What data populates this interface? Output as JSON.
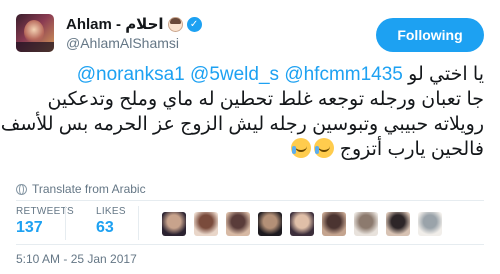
{
  "user": {
    "display_name": "Ahlam - احلام",
    "handle": "@AhlamAlShamsi",
    "verified": true,
    "avatar_icon": "profile-photo"
  },
  "follow_button": {
    "label": "Following",
    "color": "#1da1f2"
  },
  "tweet": {
    "lines": [
      [
        "@noranksa1 ",
        "@5weld_s ",
        "@hfcmm1435 ",
        "يا اختي لو"
      ],
      "جا تعبان ورجله توجعه غلط تحطين له ماي وملح وتدعكين",
      "رويلاته حبيبي وتبوسين رجله ليش الزوج عز الحرمه بس للأسف",
      "فالحين يارب أتزوج"
    ],
    "mentions": [
      "@noranksa1",
      "@5weld_s",
      "@hfcmm1435"
    ],
    "emojis": [
      "face-with-tears-of-joy",
      "face-with-tears-of-joy"
    ]
  },
  "translate": {
    "label": "Translate from Arabic",
    "icon": "globe-icon"
  },
  "stats": {
    "retweets_label": "RETWEETS",
    "retweets_value": "137",
    "likes_label": "LIKES",
    "likes_value": "63"
  },
  "likers": [
    {
      "colors": [
        "#2b2230",
        "#c8a38c"
      ]
    },
    {
      "colors": [
        "#e9d6c9",
        "#7a4b3c"
      ]
    },
    {
      "colors": [
        "#d7b9a4",
        "#5a3c3a"
      ]
    },
    {
      "colors": [
        "#1d1a1f",
        "#b39077"
      ]
    },
    {
      "colors": [
        "#3b2d3a",
        "#e0bfa8"
      ]
    },
    {
      "colors": [
        "#c4a48f",
        "#4b3431"
      ]
    },
    {
      "colors": [
        "#e8e2dc",
        "#8c7a6e"
      ]
    },
    {
      "colors": [
        "#d7c2b3",
        "#2d2628"
      ]
    },
    {
      "colors": [
        "#f1eeea",
        "#9aa3aa"
      ]
    }
  ],
  "timestamp": "5:10 AM - 25 Jan 2017",
  "colors": {
    "link": "#1da1f2",
    "muted": "#657786",
    "text": "#14171a"
  }
}
